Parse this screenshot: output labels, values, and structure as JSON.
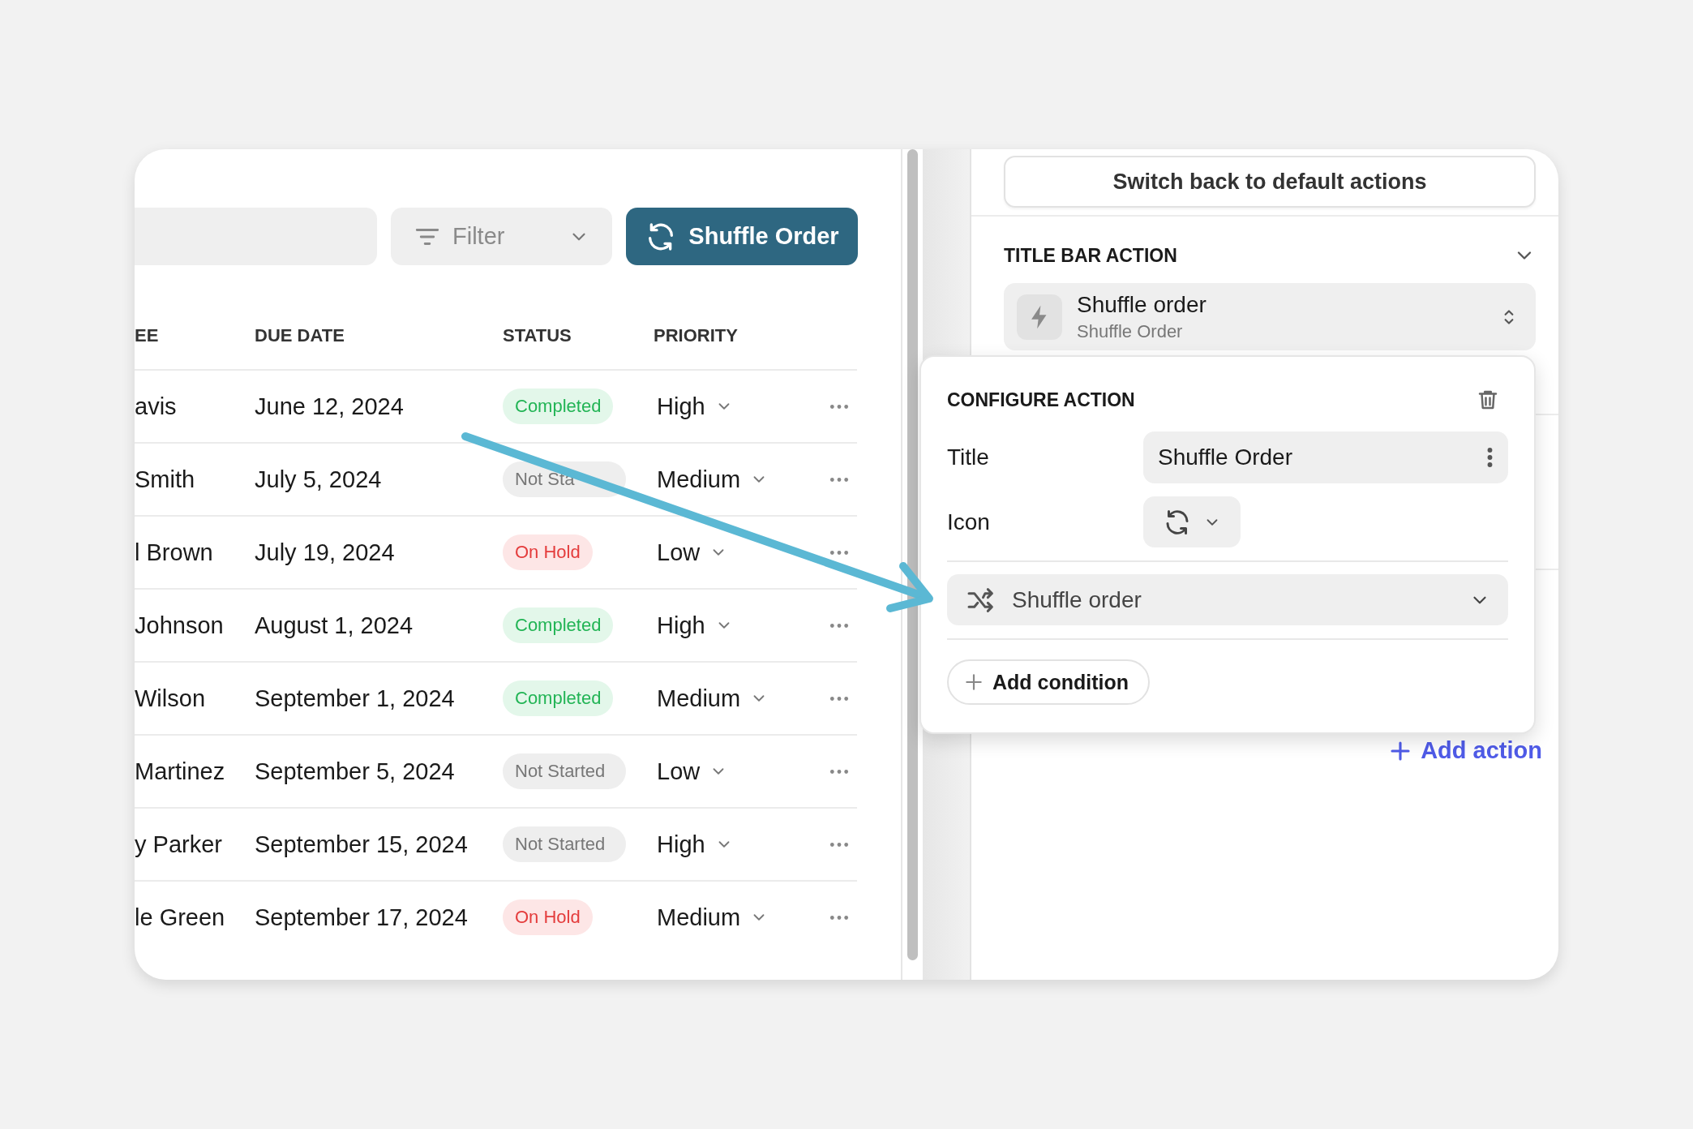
{
  "toolbar": {
    "filter": {
      "label": "Filter"
    },
    "primary_button": {
      "label": "Shuffle Order"
    }
  },
  "table": {
    "columns": [
      "EE",
      "DUE DATE",
      "STATUS",
      "PRIORITY"
    ],
    "rows": [
      {
        "assignee": "avis",
        "due_date": "June 12, 2024",
        "status": {
          "label": "Completed",
          "kind": "completed"
        },
        "priority": "High"
      },
      {
        "assignee": "Smith",
        "due_date": "July 5, 2024",
        "status": {
          "label": "Not Sta",
          "kind": "not_started"
        },
        "priority": "Medium"
      },
      {
        "assignee": "l Brown",
        "due_date": "July 19, 2024",
        "status": {
          "label": "On Hold",
          "kind": "on_hold"
        },
        "priority": "Low"
      },
      {
        "assignee": "Johnson",
        "due_date": "August 1, 2024",
        "status": {
          "label": "Completed",
          "kind": "completed"
        },
        "priority": "High"
      },
      {
        "assignee": "Wilson",
        "due_date": "September 1, 2024",
        "status": {
          "label": "Completed",
          "kind": "completed"
        },
        "priority": "Medium"
      },
      {
        "assignee": "Martinez",
        "due_date": "September 5, 2024",
        "status": {
          "label": "Not Started",
          "kind": "not_started"
        },
        "priority": "Low"
      },
      {
        "assignee": "y Parker",
        "due_date": "September 15, 2024",
        "status": {
          "label": "Not Started",
          "kind": "not_started"
        },
        "priority": "High"
      },
      {
        "assignee": "le Green",
        "due_date": "September 17, 2024",
        "status": {
          "label": "On Hold",
          "kind": "on_hold"
        },
        "priority": "Medium"
      }
    ]
  },
  "side_panel": {
    "reset_button": "Switch back to default actions",
    "section": {
      "title": "TITLE BAR ACTION",
      "expanded": true
    },
    "action_selector": {
      "title": "Shuffle order",
      "subtitle": "Shuffle Order"
    },
    "add_action": "Add action"
  },
  "popover": {
    "title": "CONFIGURE ACTION",
    "title_field": {
      "label": "Title",
      "value": "Shuffle Order"
    },
    "icon_field": {
      "label": "Icon"
    },
    "action": "Shuffle order",
    "add_condition": "Add condition"
  }
}
